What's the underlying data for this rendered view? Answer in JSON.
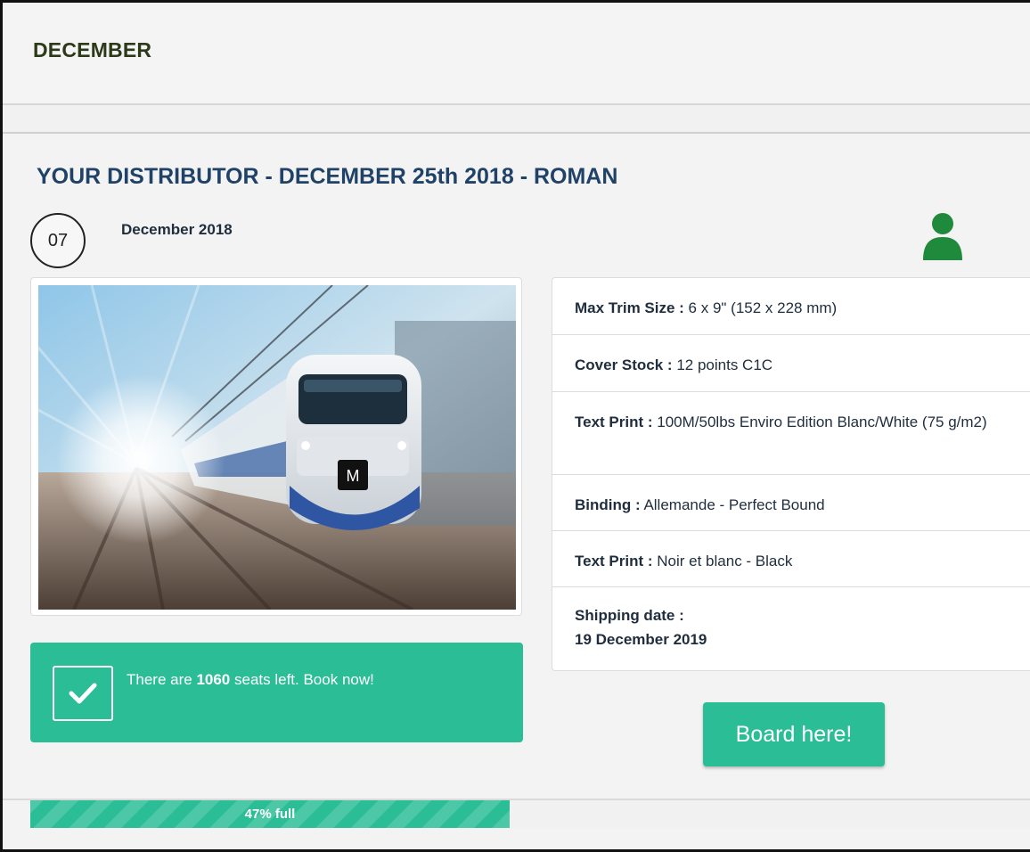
{
  "header": {
    "title": "DECEMBER"
  },
  "event": {
    "title": "YOUR DISTRIBUTOR - DECEMBER 25th 2018 - ROMAN",
    "day": "07",
    "month": "December 2018",
    "user_icon": "user-icon",
    "image": {
      "subject": "train-photo",
      "badge": "M"
    }
  },
  "notice": {
    "icon": "checkmark-icon",
    "text_before": "There are ",
    "seats": "1060",
    "text_after": " seats left. Book now!"
  },
  "specs": [
    {
      "label": "Max Trim Size :",
      "value": " 6 x 9\" (152 x 228 mm)"
    },
    {
      "label": "Cover Stock :",
      "value": " 12 points C1C"
    },
    {
      "label": "Text Print :",
      "value": " 100M/50lbs Enviro Edition Blanc/White (75 g/m2)"
    },
    {
      "label": "Binding :",
      "value": " Allemande - Perfect Bound"
    },
    {
      "label": "Text Print :",
      "value": " Noir et blanc - Black"
    },
    {
      "label": "Shipping date :",
      "value": "19 December 2019"
    }
  ],
  "board_button": {
    "label": "Board here!"
  },
  "progress": {
    "percent": 47,
    "label": "47% full"
  },
  "colors": {
    "accent": "#2bbd96",
    "title": "#1f4266",
    "user_icon": "#1f8a3c"
  }
}
